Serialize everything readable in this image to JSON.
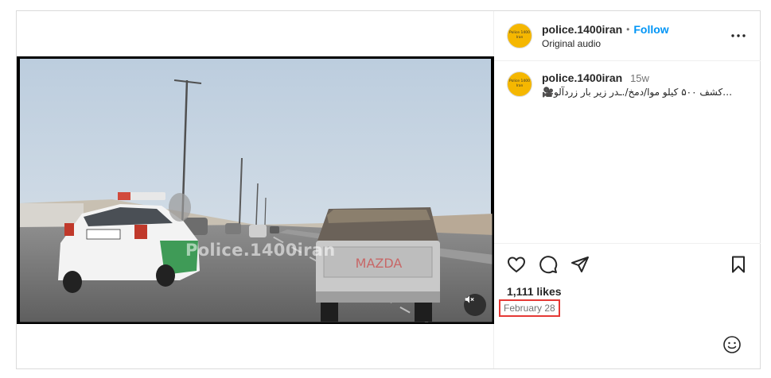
{
  "author": {
    "username": "police.1400iran",
    "follow_label": "Follow",
    "separator": "•",
    "audio": "Original audio",
    "avatar_text": [
      "Police 1400",
      "Iran"
    ]
  },
  "video": {
    "watermark": "Police.1400iran",
    "muted": true
  },
  "caption": {
    "username": "police.1400iran",
    "age": "15w",
    "text": "…کشف ۵۰۰ کیلو موا/دمخ/.ـدر زیر بار زردآلو🎥"
  },
  "stats": {
    "likes": "1,111 likes",
    "date": "February 28"
  },
  "icons": {
    "like": "heart-icon",
    "comment": "comment-icon",
    "share": "send-icon",
    "save": "bookmark-icon",
    "more": "more-options-icon",
    "mute": "muted-speaker-icon",
    "emoji": "emoji-icon"
  },
  "colors": {
    "accent": "#0095f6",
    "highlight_box": "#e53935",
    "avatar_bg": "#f5b700"
  }
}
